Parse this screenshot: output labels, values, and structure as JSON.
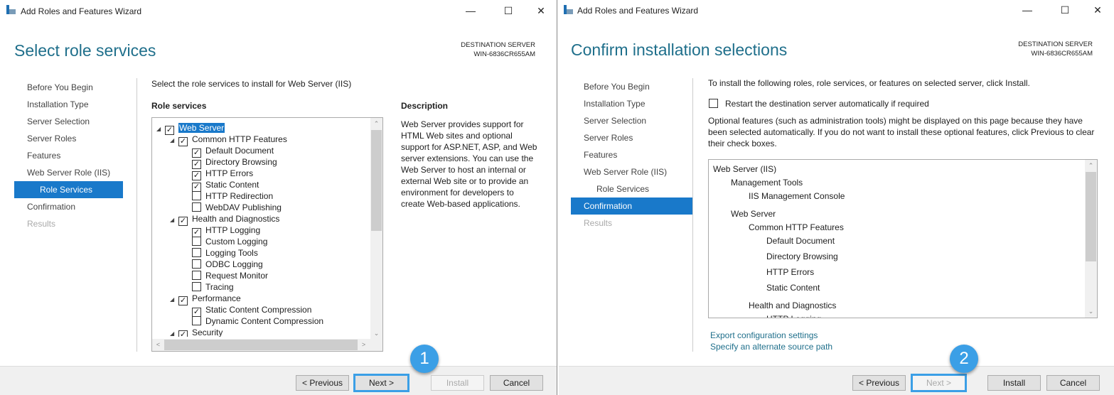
{
  "left": {
    "title": "Add Roles and Features Wizard",
    "heading": "Select role services",
    "dest_label": "DESTINATION SERVER",
    "dest_server": "WIN-6836CR655AM",
    "nav": [
      "Before You Begin",
      "Installation Type",
      "Server Selection",
      "Server Roles",
      "Features",
      "Web Server Role (IIS)",
      "Role Services",
      "Confirmation",
      "Results"
    ],
    "instruction": "Select the role services to install for Web Server (IIS)",
    "role_services_label": "Role services",
    "description_label": "Description",
    "description": "Web Server provides support for HTML Web sites and optional support for ASP.NET, ASP, and Web server extensions. You can use the Web Server to host an internal or external Web site or to provide an environment for developers to create Web-based applications.",
    "tree": [
      {
        "label": "Web Server",
        "level": 0,
        "checked": true,
        "expander": true,
        "selected": true
      },
      {
        "label": "Common HTTP Features",
        "level": 1,
        "checked": true,
        "expander": true
      },
      {
        "label": "Default Document",
        "level": 2,
        "checked": true
      },
      {
        "label": "Directory Browsing",
        "level": 2,
        "checked": true
      },
      {
        "label": "HTTP Errors",
        "level": 2,
        "checked": true
      },
      {
        "label": "Static Content",
        "level": 2,
        "checked": true
      },
      {
        "label": "HTTP Redirection",
        "level": 2,
        "checked": false
      },
      {
        "label": "WebDAV Publishing",
        "level": 2,
        "checked": false
      },
      {
        "label": "Health and Diagnostics",
        "level": 1,
        "checked": true,
        "expander": true
      },
      {
        "label": "HTTP Logging",
        "level": 2,
        "checked": true
      },
      {
        "label": "Custom Logging",
        "level": 2,
        "checked": false
      },
      {
        "label": "Logging Tools",
        "level": 2,
        "checked": false
      },
      {
        "label": "ODBC Logging",
        "level": 2,
        "checked": false
      },
      {
        "label": "Request Monitor",
        "level": 2,
        "checked": false
      },
      {
        "label": "Tracing",
        "level": 2,
        "checked": false
      },
      {
        "label": "Performance",
        "level": 1,
        "checked": true,
        "expander": true
      },
      {
        "label": "Static Content Compression",
        "level": 2,
        "checked": true
      },
      {
        "label": "Dynamic Content Compression",
        "level": 2,
        "checked": false
      },
      {
        "label": "Security",
        "level": 1,
        "checked": true,
        "expander": true
      }
    ],
    "buttons": {
      "previous": "< Previous",
      "next": "Next >",
      "install": "Install",
      "cancel": "Cancel"
    },
    "badge": "1"
  },
  "right": {
    "title": "Add Roles and Features Wizard",
    "heading": "Confirm installation selections",
    "dest_label": "DESTINATION SERVER",
    "dest_server": "WIN-6836CR655AM",
    "nav": [
      "Before You Begin",
      "Installation Type",
      "Server Selection",
      "Server Roles",
      "Features",
      "Web Server Role (IIS)",
      "Role Services",
      "Confirmation",
      "Results"
    ],
    "instruction": "To install the following roles, role services, or features on selected server, click Install.",
    "restart_label": "Restart the destination server automatically if required",
    "restart_checked": false,
    "optional_note": "Optional features (such as administration tools) might be displayed on this page because they have been selected automatically. If you do not want to install these optional features, click Previous to clear their check boxes.",
    "items": [
      {
        "label": "Web Server (IIS)",
        "level": 0
      },
      {
        "label": "Management Tools",
        "level": 1
      },
      {
        "label": "IIS Management Console",
        "level": 2
      },
      {
        "label": "Web Server",
        "level": 1
      },
      {
        "label": "Common HTTP Features",
        "level": 2
      },
      {
        "label": "Default Document",
        "level": 3
      },
      {
        "label": "Directory Browsing",
        "level": 3
      },
      {
        "label": "HTTP Errors",
        "level": 3
      },
      {
        "label": "Static Content",
        "level": 3
      },
      {
        "label": "Health and Diagnostics",
        "level": 2
      },
      {
        "label": "HTTP Logging",
        "level": 3
      }
    ],
    "export_link": "Export configuration settings",
    "alt_source_link": "Specify an alternate source path",
    "buttons": {
      "previous": "< Previous",
      "next": "Next >",
      "install": "Install",
      "cancel": "Cancel"
    },
    "badge": "2"
  },
  "accent": "#1979ca",
  "badge_color": "#3b9fe6"
}
